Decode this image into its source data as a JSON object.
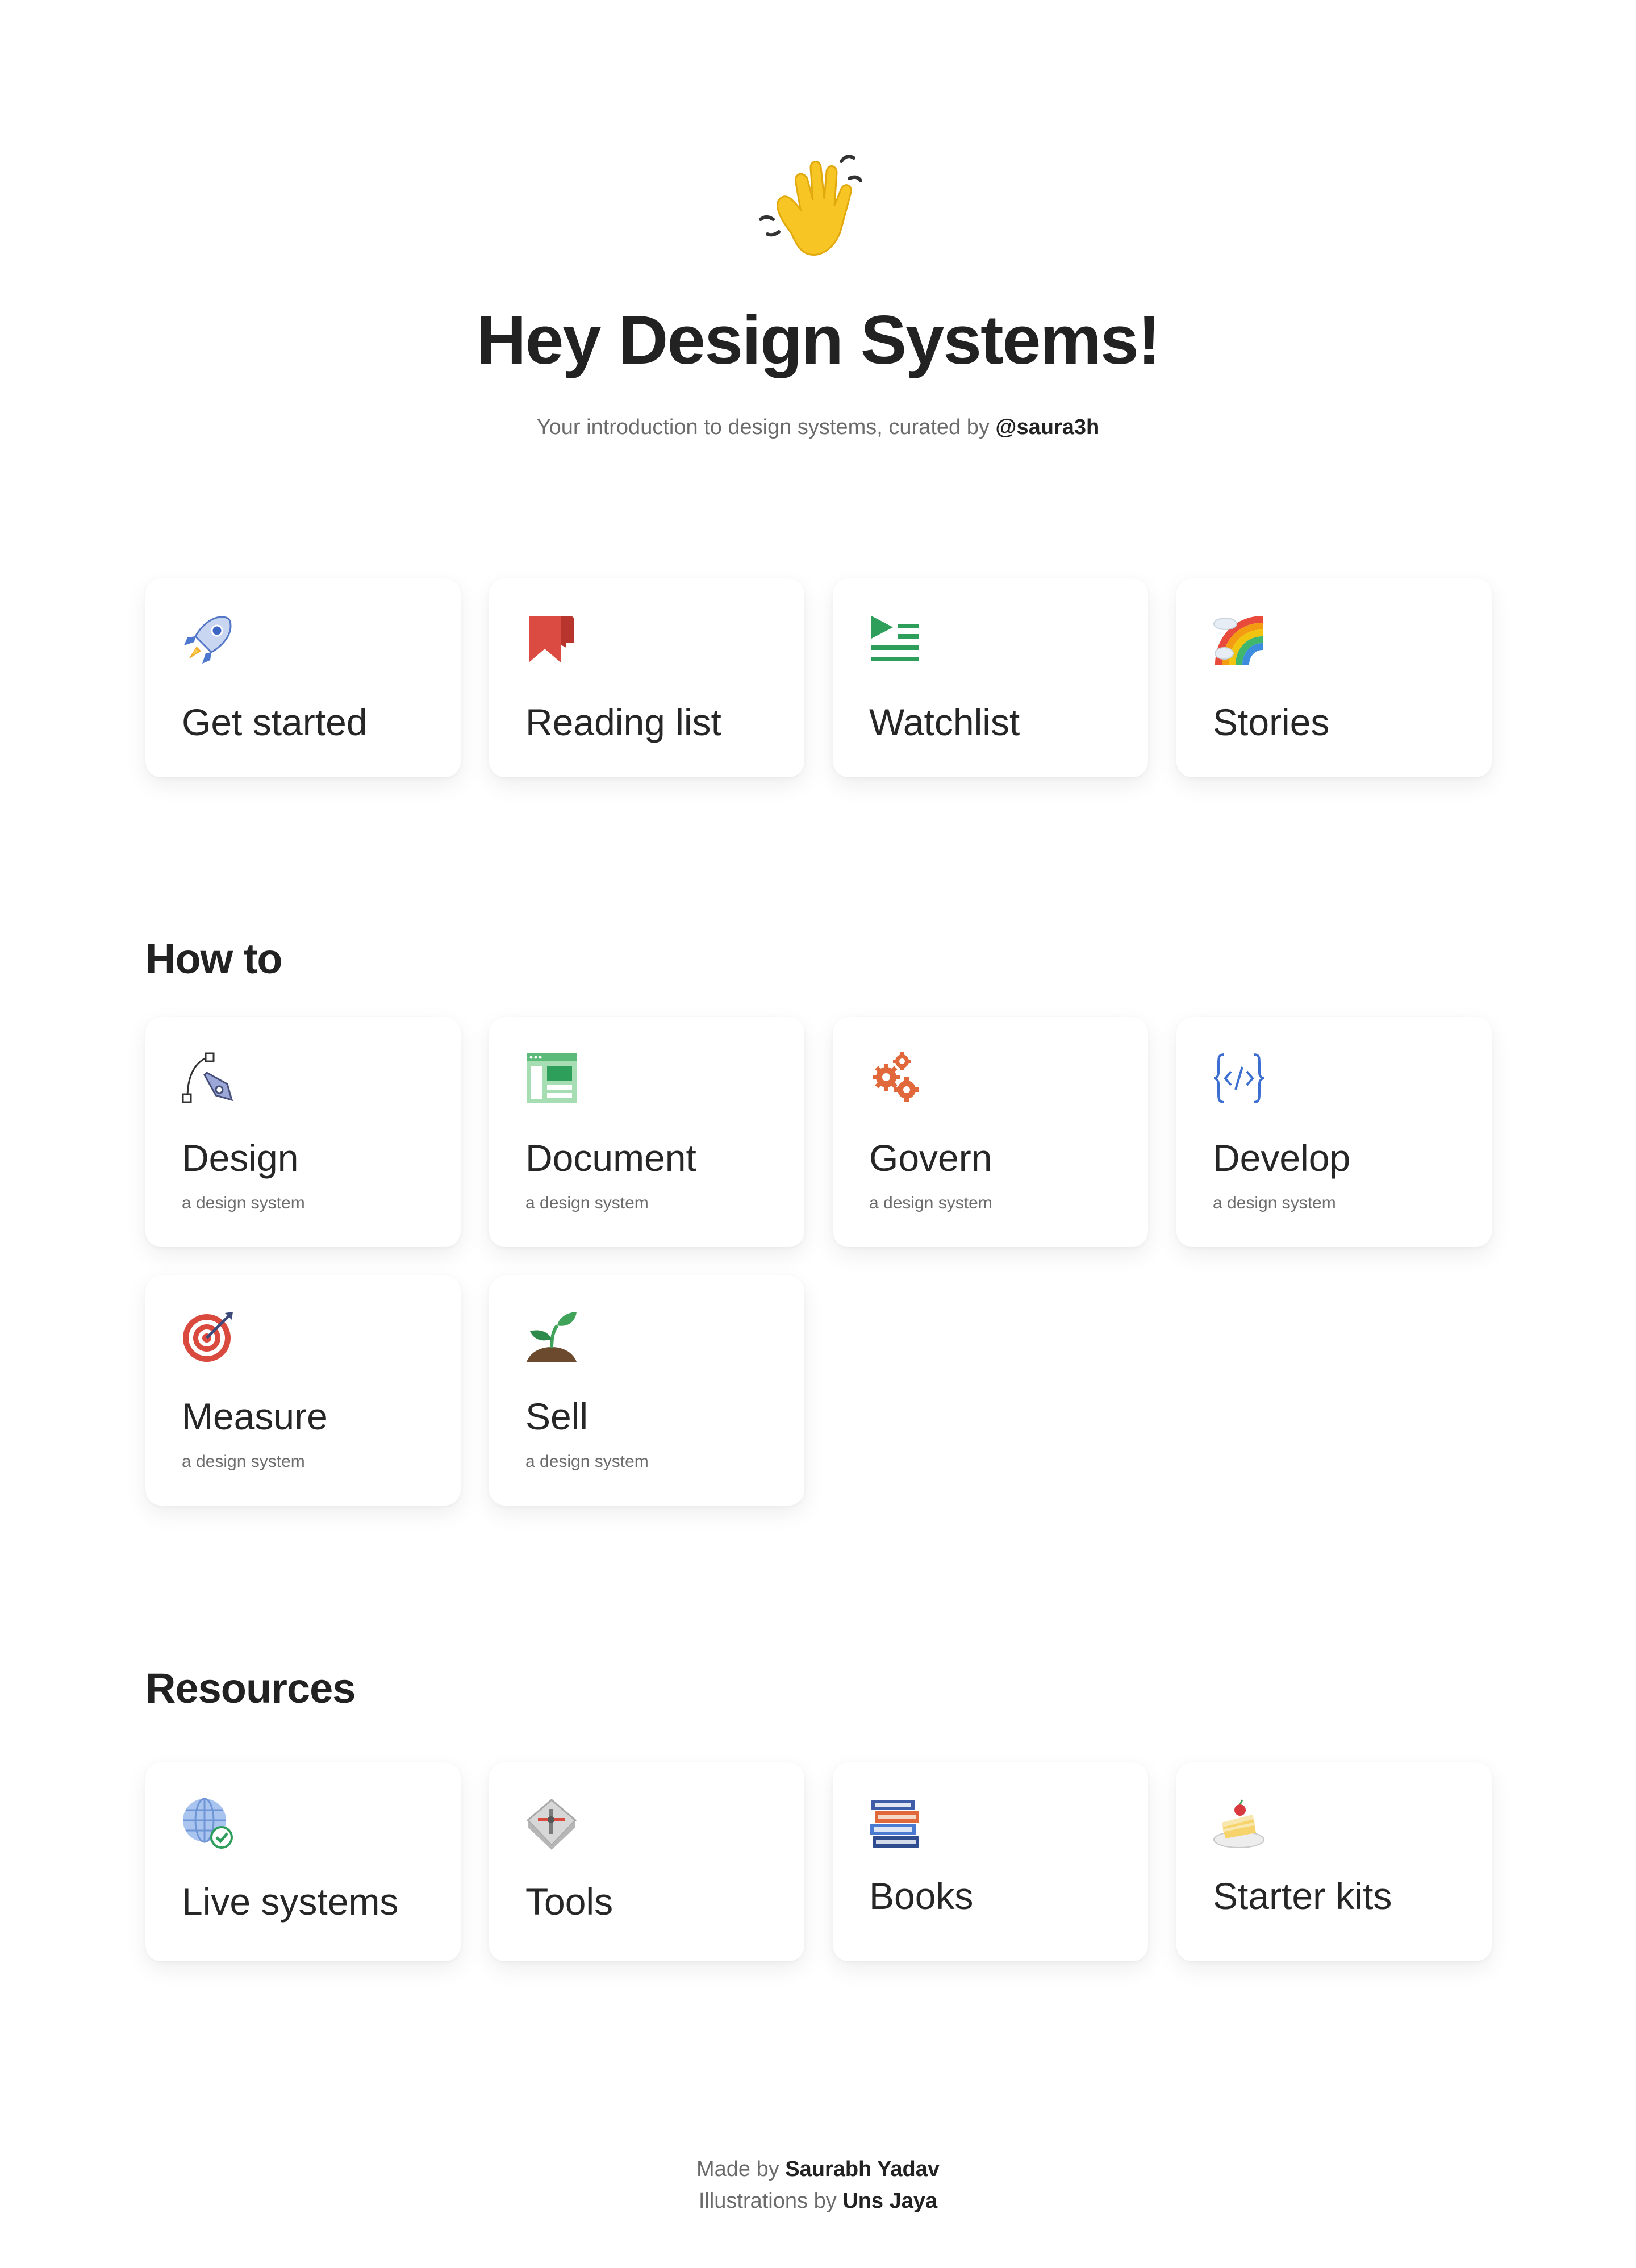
{
  "hero": {
    "icon": "waving-hand-icon",
    "title": "Hey Design Systems!",
    "subtitle_prefix": "Your introduction to design systems, curated by ",
    "subtitle_handle": "@saura3h"
  },
  "quick_links": [
    {
      "label": "Get started",
      "icon": "rocket-icon"
    },
    {
      "label": "Reading list",
      "icon": "bookmark-icon"
    },
    {
      "label": "Watchlist",
      "icon": "playlist-icon"
    },
    {
      "label": "Stories",
      "icon": "rainbow-icon"
    }
  ],
  "how_to": {
    "title": "How to",
    "items": [
      {
        "label": "Design",
        "sub": "a design system",
        "icon": "pen-tool-icon"
      },
      {
        "label": "Document",
        "sub": "a design system",
        "icon": "document-layout-icon"
      },
      {
        "label": "Govern",
        "sub": "a design system",
        "icon": "gears-icon"
      },
      {
        "label": "Develop",
        "sub": "a design system",
        "icon": "code-braces-icon"
      },
      {
        "label": "Measure",
        "sub": "a design system",
        "icon": "target-icon"
      },
      {
        "label": "Sell",
        "sub": "a design system",
        "icon": "seedling-icon"
      }
    ]
  },
  "resources": {
    "title": "Resources",
    "items": [
      {
        "label": "Live systems",
        "icon": "globe-check-icon"
      },
      {
        "label": "Tools",
        "icon": "tools-icon"
      },
      {
        "label": "Books",
        "icon": "books-icon"
      },
      {
        "label": "Starter kits",
        "icon": "cake-icon"
      }
    ]
  },
  "footer": {
    "made_by_prefix": "Made by ",
    "made_by_name": "Saurabh Yadav",
    "illustrations_prefix": "Illustrations by ",
    "illustrations_name": "Uns Jaya"
  },
  "colors": {
    "text": "#222222",
    "muted": "#6b6b6b",
    "card_bg": "#ffffff",
    "page_bg": "#ffffff"
  }
}
